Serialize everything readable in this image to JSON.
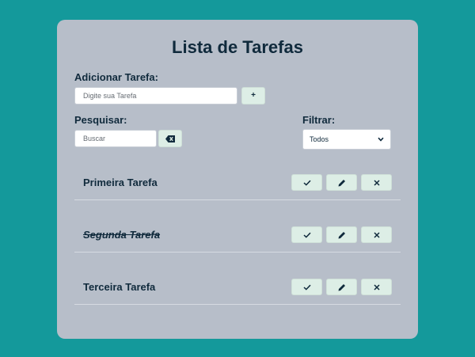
{
  "title": "Lista de Tarefas",
  "add": {
    "label": "Adicionar Tarefa:",
    "placeholder": "Digite sua Tarefa",
    "button_label": "+"
  },
  "search": {
    "label": "Pesquisar:",
    "placeholder": "Buscar",
    "clear_icon": "backspace-icon"
  },
  "filter": {
    "label": "Filtrar:",
    "selected": "Todos",
    "options": [
      "Todos"
    ]
  },
  "tasks": [
    {
      "name": "Primeira Tarefa",
      "done": false
    },
    {
      "name": "Segunda Tarefa",
      "done": true
    },
    {
      "name": "Terceira Tarefa",
      "done": false
    }
  ],
  "task_actions": [
    "check-icon",
    "pencil-icon",
    "close-icon"
  ],
  "colors": {
    "background": "#14999b",
    "card": "#b7bec9",
    "text": "#102a3c",
    "button": "#ddeee6"
  }
}
